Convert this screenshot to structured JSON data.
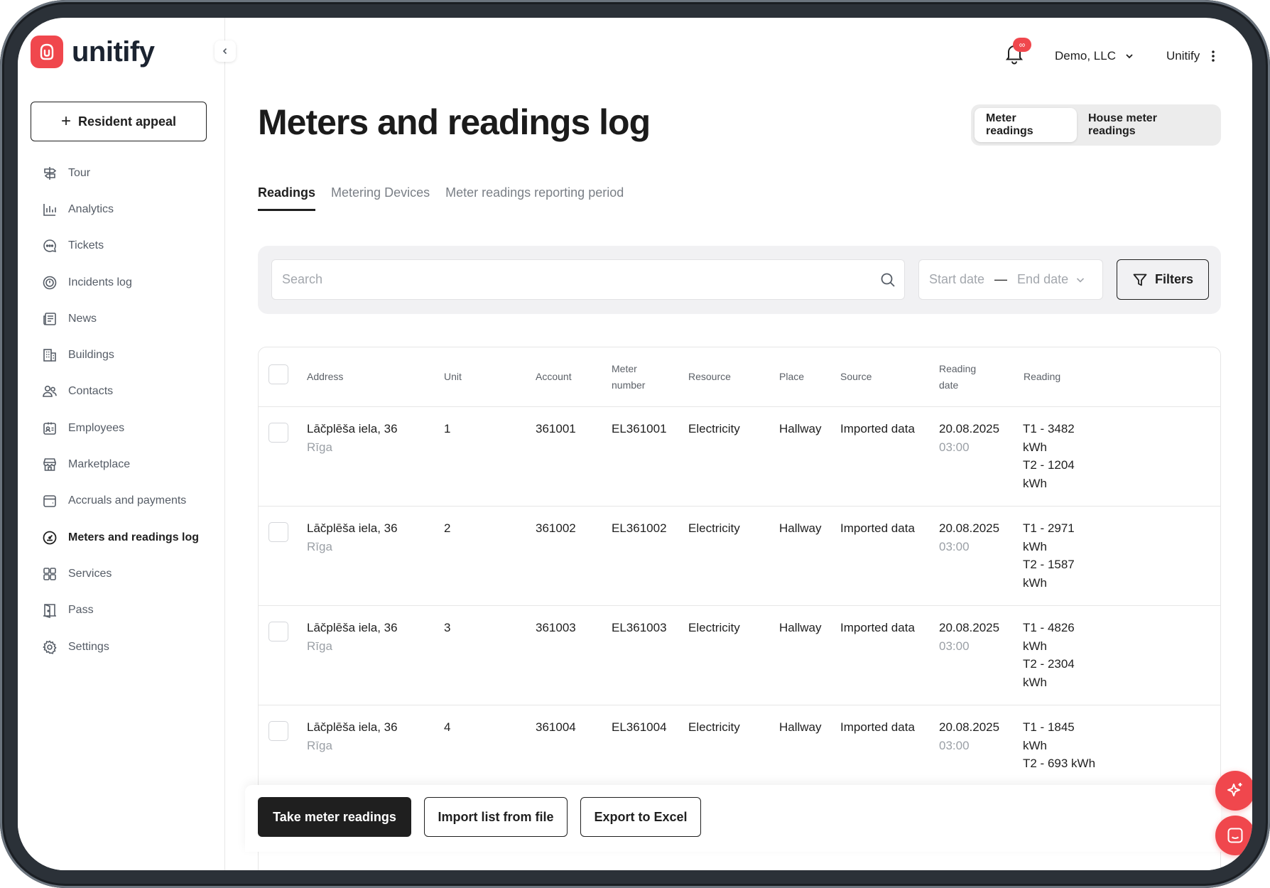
{
  "app": {
    "name": "unitify"
  },
  "sidebar": {
    "appeal_label": "Resident appeal",
    "items": [
      {
        "label": "Tour",
        "icon": "signpost-icon"
      },
      {
        "label": "Analytics",
        "icon": "bar-chart-icon"
      },
      {
        "label": "Tickets",
        "icon": "chat-bubble-icon"
      },
      {
        "label": "Incidents log",
        "icon": "alert-circle-icon"
      },
      {
        "label": "News",
        "icon": "newspaper-icon"
      },
      {
        "label": "Buildings",
        "icon": "building-icon"
      },
      {
        "label": "Contacts",
        "icon": "people-icon"
      },
      {
        "label": "Employees",
        "icon": "id-badge-icon"
      },
      {
        "label": "Marketplace",
        "icon": "store-icon"
      },
      {
        "label": "Accruals and payments",
        "icon": "wallet-icon"
      },
      {
        "label": "Meters and readings log",
        "icon": "meter-icon",
        "active": true
      },
      {
        "label": "Services",
        "icon": "grid-icon"
      },
      {
        "label": "Pass",
        "icon": "door-icon"
      },
      {
        "label": "Settings",
        "icon": "gear-icon"
      }
    ]
  },
  "topbar": {
    "notifications_badge": "∞",
    "organization": "Demo, LLC",
    "user": "Unitify"
  },
  "page": {
    "title": "Meters and readings log",
    "segments": [
      "Meter readings",
      "House meter readings"
    ],
    "active_segment": "Meter readings",
    "tabs": [
      "Readings",
      "Metering Devices",
      "Meter readings reporting period"
    ],
    "active_tab": "Readings"
  },
  "filters": {
    "search_placeholder": "Search",
    "start_date_placeholder": "Start date",
    "end_date_placeholder": "End date",
    "filters_label": "Filters"
  },
  "table": {
    "columns": {
      "address": "Address",
      "unit": "Unit",
      "account": "Account",
      "meter_number_1": "Meter",
      "meter_number_2": "number",
      "resource": "Resource",
      "place": "Place",
      "source": "Source",
      "reading_date_1": "Reading",
      "reading_date_2": "date",
      "reading": "Reading"
    },
    "rows": [
      {
        "address": "Lāčplēša iela, 36",
        "city": "Rīga",
        "unit": "1",
        "account": "361001",
        "meter": "EL361001",
        "resource": "Electricity",
        "place": "Hallway",
        "source": "Imported data",
        "date": "20.08.2025",
        "time": "03:00",
        "r1": "T1 - 3482",
        "r1u": "kWh",
        "r2": "T2 - 1204",
        "r2u": "kWh"
      },
      {
        "address": "Lāčplēša iela, 36",
        "city": "Rīga",
        "unit": "2",
        "account": "361002",
        "meter": "EL361002",
        "resource": "Electricity",
        "place": "Hallway",
        "source": "Imported data",
        "date": "20.08.2025",
        "time": "03:00",
        "r1": "T1 - 2971",
        "r1u": "kWh",
        "r2": "T2 - 1587",
        "r2u": "kWh"
      },
      {
        "address": "Lāčplēša iela, 36",
        "city": "Rīga",
        "unit": "3",
        "account": "361003",
        "meter": "EL361003",
        "resource": "Electricity",
        "place": "Hallway",
        "source": "Imported data",
        "date": "20.08.2025",
        "time": "03:00",
        "r1": "T1 - 4826",
        "r1u": "kWh",
        "r2": "T2 - 2304",
        "r2u": "kWh"
      },
      {
        "address": "Lāčplēša iela, 36",
        "city": "Rīga",
        "unit": "4",
        "account": "361004",
        "meter": "EL361004",
        "resource": "Electricity",
        "place": "Hallway",
        "source": "Imported data",
        "date": "20.08.2025",
        "time": "03:00",
        "r1": "T1 - 1845",
        "r1u": "kWh",
        "r2": "T2 - 693 kWh",
        "r2u": ""
      }
    ],
    "tail_unit": "kWh"
  },
  "actions": {
    "take_readings": "Take meter readings",
    "import": "Import list from file",
    "export": "Export to Excel"
  },
  "colors": {
    "brand": "#f0474d",
    "text": "#1f1f1f",
    "muted": "#9ba0a6"
  }
}
